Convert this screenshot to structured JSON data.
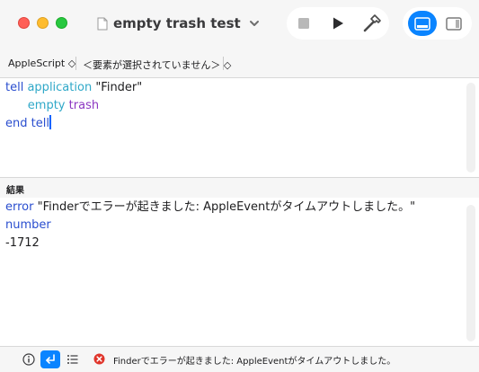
{
  "window": {
    "title": "empty trash test"
  },
  "toolbar": {
    "stop_icon": "stop-icon",
    "run_icon": "play-icon",
    "compile_icon": "hammer-icon",
    "view_result_icon": "bottom-panel-icon",
    "view_sidebar_icon": "sidebar-icon"
  },
  "navbar": {
    "language": "AppleScript ◇",
    "element": "＜要素が選択されていません＞ ◇"
  },
  "editor": {
    "lines": [
      [
        {
          "text": "tell",
          "style": "kw-blue"
        },
        {
          "text": " ",
          "style": "plain"
        },
        {
          "text": "application",
          "style": "kw-cyan"
        },
        {
          "text": " \"Finder\"",
          "style": "plain"
        }
      ],
      [
        {
          "text": "      ",
          "style": "plain"
        },
        {
          "text": "empty",
          "style": "kw-cyan"
        },
        {
          "text": " ",
          "style": "plain"
        },
        {
          "text": "trash",
          "style": "kw-purple"
        }
      ],
      [
        {
          "text": "end",
          "style": "kw-blue"
        },
        {
          "text": " ",
          "style": "plain"
        },
        {
          "text": "tell",
          "style": "kw-blue"
        }
      ]
    ]
  },
  "result": {
    "header": "結果",
    "keyword": "error",
    "message": " \"Finderでエラーが起きました: AppleEventがタイムアウトしました。\" ",
    "number_keyword": "number",
    "number_value": "-1712"
  },
  "statusbar": {
    "message": "Finderでエラーが起きました: AppleEventがタイムアウトしました。"
  },
  "colors": {
    "accent": "#0a84ff",
    "error": "#e0352b"
  }
}
